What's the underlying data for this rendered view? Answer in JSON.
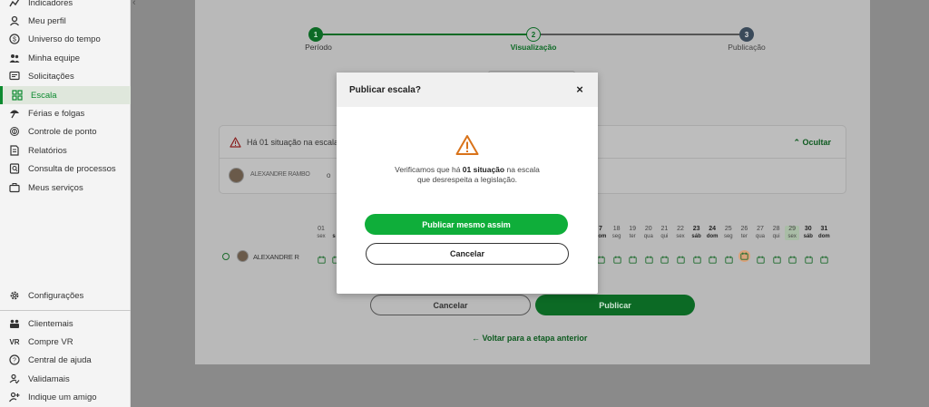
{
  "sidebar": {
    "items": [
      {
        "label": "Indicadores",
        "icon": "chart-line-icon"
      },
      {
        "label": "Meu perfil",
        "icon": "user-icon"
      },
      {
        "label": "Universo do tempo",
        "icon": "dollar-circle-icon"
      },
      {
        "label": "Minha equipe",
        "icon": "team-icon"
      },
      {
        "label": "Solicitações",
        "icon": "message-icon"
      },
      {
        "label": "Escala",
        "icon": "grid-icon",
        "active": true
      },
      {
        "label": "Férias e folgas",
        "icon": "umbrella-icon"
      },
      {
        "label": "Controle de ponto",
        "icon": "fingerprint-icon"
      },
      {
        "label": "Relatórios",
        "icon": "document-icon"
      },
      {
        "label": "Consulta de processos",
        "icon": "search-doc-icon"
      },
      {
        "label": "Meus serviços",
        "icon": "briefcase-icon"
      }
    ],
    "settings_label": "Configurações",
    "bottom_items": [
      {
        "label": "Clientemais",
        "icon": "people-icon"
      },
      {
        "label": "Compre VR",
        "icon": "vr-icon"
      },
      {
        "label": "Central de ajuda",
        "icon": "help-icon"
      },
      {
        "label": "Validamais",
        "icon": "check-user-icon"
      },
      {
        "label": "Indique um amigo",
        "icon": "add-friend-icon"
      }
    ]
  },
  "stepper": {
    "steps": [
      {
        "number": "1",
        "label": "Período",
        "state": "done"
      },
      {
        "number": "2",
        "label": "Visualização",
        "state": "current"
      },
      {
        "number": "3",
        "label": "Publicação",
        "state": "pending"
      }
    ]
  },
  "alert": {
    "text": "Há 01 situação na escala c",
    "hide_label": "Ocultar",
    "person_name": "ALEXANDRE RAMBO",
    "person_suffix": "o"
  },
  "calendar": {
    "first_day": {
      "num": "01",
      "dow": "sex"
    },
    "second_day_dow": "s",
    "days": [
      {
        "num": "7",
        "dow": "dom",
        "bold": true
      },
      {
        "num": "18",
        "dow": "seg"
      },
      {
        "num": "19",
        "dow": "ter"
      },
      {
        "num": "20",
        "dow": "qua"
      },
      {
        "num": "21",
        "dow": "qui"
      },
      {
        "num": "22",
        "dow": "sex"
      },
      {
        "num": "23",
        "dow": "sáb",
        "bold": true
      },
      {
        "num": "24",
        "dow": "dom",
        "bold": true
      },
      {
        "num": "25",
        "dow": "seg"
      },
      {
        "num": "26",
        "dow": "ter"
      },
      {
        "num": "27",
        "dow": "qua"
      },
      {
        "num": "28",
        "dow": "qui"
      },
      {
        "num": "29",
        "dow": "sex",
        "highlight": true
      },
      {
        "num": "30",
        "dow": "sáb",
        "bold": true
      },
      {
        "num": "31",
        "dow": "dom",
        "bold": true
      }
    ],
    "employee_name": "ALEXANDRE R",
    "warning_day": "26"
  },
  "footer": {
    "cancel_label": "Cancelar",
    "publish_label": "Publicar",
    "back_label": "Voltar para a etapa anterior"
  },
  "modal": {
    "title": "Publicar escala?",
    "message_prefix": "Verificamos que há ",
    "message_bold": "01 situação",
    "message_suffix": " na escala",
    "message_line2": "que desrespeita a legislação.",
    "primary_label": "Publicar mesmo assim",
    "secondary_label": "Cancelar"
  },
  "colors": {
    "brand_green": "#0fae3a",
    "warning_orange": "#d9731a"
  }
}
